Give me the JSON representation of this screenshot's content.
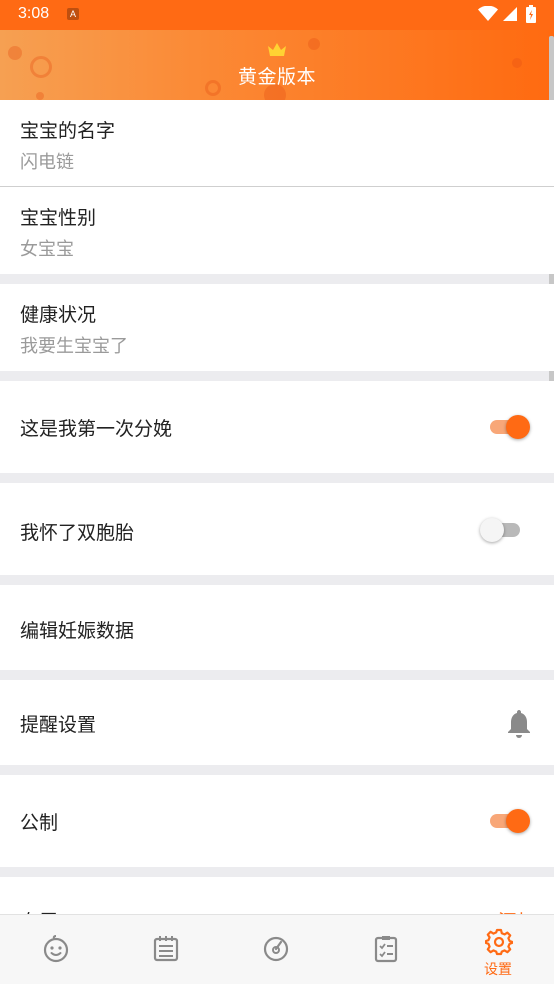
{
  "status_bar": {
    "time": "3:08",
    "notification_icon": "A"
  },
  "header": {
    "title": "黄金版本",
    "icon": "crown-icon"
  },
  "settings": {
    "baby_name": {
      "label": "宝宝的名字",
      "value": "闪电链"
    },
    "baby_gender": {
      "label": "宝宝性别",
      "value": "女宝宝"
    },
    "health": {
      "label": "健康状况",
      "value": "我要生宝宝了"
    },
    "first_birth": {
      "label": "这是我第一次分娩",
      "enabled": true
    },
    "twins": {
      "label": "我怀了双胞胎",
      "enabled": false
    },
    "edit_pregnancy": {
      "label": "编辑妊娠数据"
    },
    "reminders": {
      "label": "提醒设置",
      "icon": "bell-icon"
    },
    "metric": {
      "label": "公制",
      "enabled": true
    },
    "partial_row": {
      "label": "专属",
      "action": "添加"
    }
  },
  "bottom_nav": {
    "items": [
      {
        "icon": "baby-face-icon",
        "label": ""
      },
      {
        "icon": "calendar-icon",
        "label": ""
      },
      {
        "icon": "gauge-icon",
        "label": ""
      },
      {
        "icon": "checklist-icon",
        "label": ""
      },
      {
        "icon": "gear-icon",
        "label": "设置",
        "active": true
      }
    ]
  },
  "colors": {
    "accent": "#ff6a14",
    "header_start": "#f6a052",
    "header_end": "#ff6a10"
  }
}
